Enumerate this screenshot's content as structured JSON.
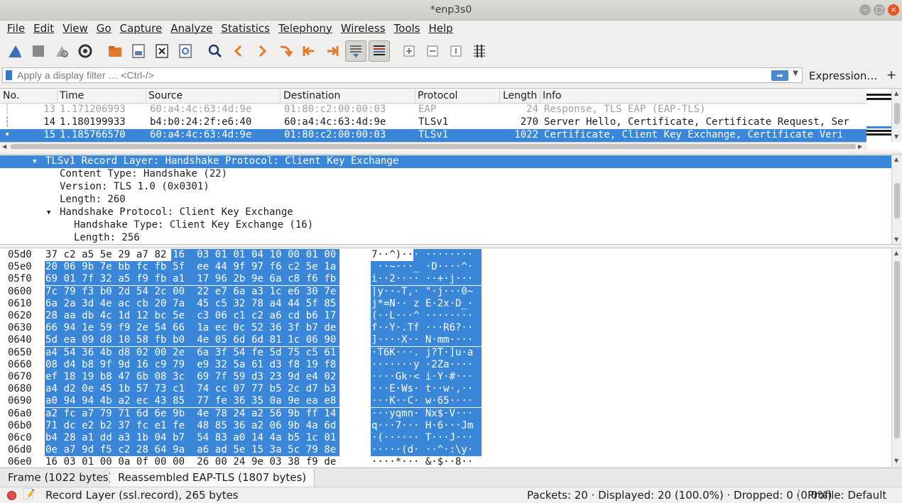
{
  "window": {
    "title": "*enp3s0"
  },
  "menu": [
    "File",
    "Edit",
    "View",
    "Go",
    "Capture",
    "Analyze",
    "Statistics",
    "Telephony",
    "Wireless",
    "Tools",
    "Help"
  ],
  "filter": {
    "placeholder": "Apply a display filter … <Ctrl-/>",
    "value": "",
    "expression_label": "Expression…",
    "add_label": "+"
  },
  "packet_list": {
    "columns": [
      "No.",
      "Time",
      "Source",
      "Destination",
      "Protocol",
      "Length",
      "Info"
    ],
    "rows": [
      {
        "no": "13",
        "time": "1.171206993",
        "source": "60:a4:4c:63:4d:9e",
        "destination": "01:80:c2:00:00:03",
        "protocol": "EAP",
        "length": "24",
        "info": "Response, TLS EAP (EAP-TLS)"
      },
      {
        "no": "14",
        "time": "1.180199933",
        "source": "b4:b0:24:2f:e6:40",
        "destination": "60:a4:4c:63:4d:9e",
        "protocol": "TLSv1",
        "length": "270",
        "info": "Server Hello, Certificate, Certificate Request, Ser"
      },
      {
        "no": "15",
        "time": "1.185766570",
        "source": "60:a4:4c:63:4d:9e",
        "destination": "01:80:c2:00:00:03",
        "protocol": "TLSv1",
        "length": "1022",
        "info": "Certificate, Client Key Exchange, Certificate Veri"
      }
    ]
  },
  "details": [
    "TLSv1 Record Layer: Handshake Protocol: Client Key Exchange",
    "Content Type: Handshake (22)",
    "Version: TLS 1.0 (0x0301)",
    "Length: 260",
    "Handshake Protocol: Client Key Exchange",
    "Handshake Type: Client Key Exchange (16)",
    "Length: 256"
  ],
  "bytes": [
    {
      "offset": "05d0",
      "hex": "37 c2 a5 5e 29 a7 82 16  03 01 01 04 10 00 01 00",
      "ascii": "7··^)··· ········"
    },
    {
      "offset": "05e0",
      "hex": "20 06 9b 7e bb fc fb 5f  ee 44 9f 97 f6 c2 5e 1a",
      "ascii": " ··~···_ ·D····^·"
    },
    {
      "offset": "05f0",
      "hex": "69 01 7f 32 a5 f9 fb a1  17 96 2b 9e 6a c8 f6 fb",
      "ascii": "i··2···· ··+·j···"
    },
    {
      "offset": "0600",
      "hex": "7c 79 f3 b0 2d 54 2c 00  22 e7 6a a3 1c e6 30 7e",
      "ascii": "|y··-T,· \"·j···0~"
    },
    {
      "offset": "0610",
      "hex": "6a 2a 3d 4e ac cb 20 7a  45 c5 32 78 a4 44 5f 85",
      "ascii": "j*=N·· z E·2x·D_·"
    },
    {
      "offset": "0620",
      "hex": "28 aa db 4c 1d 12 bc 5e  c3 06 c1 c2 a6 cd b6 17",
      "ascii": "(··L···^ ········"
    },
    {
      "offset": "0630",
      "hex": "66 94 1e 59 f9 2e 54 66  1a ec 0c 52 36 3f b7 de",
      "ascii": "f··Y·.Tf ···R6?··"
    },
    {
      "offset": "0640",
      "hex": "5d ea 09 d8 10 58 fb b0  4e 05 6d 6d 81 1c 06 90",
      "ascii": "]····X·· N·mm····"
    },
    {
      "offset": "0650",
      "hex": "a4 54 36 4b d8 02 00 2e  6a 3f 54 fe 5d 75 c5 61",
      "ascii": "·T6K···. j?T·]u·a"
    },
    {
      "offset": "0660",
      "hex": "08 d4 b8 9f 9d 16 c9 79  e9 32 5a 61 d3 f8 19 f8",
      "ascii": "·······y ·2Za····"
    },
    {
      "offset": "0670",
      "hex": "ef 18 19 b8 47 6b 08 3c  69 7f 59 d3 23 9d e4 02",
      "ascii": "····Gk·< i·Y·#···"
    },
    {
      "offset": "0680",
      "hex": "a4 d2 0e 45 1b 57 73 c1  74 cc 07 77 b5 2c d7 b3",
      "ascii": "···E·Ws· t··w·,··"
    },
    {
      "offset": "0690",
      "hex": "a0 94 94 4b a2 ec 43 85  77 fe 36 35 0a 9e ea e8",
      "ascii": "···K··C· w·65····"
    },
    {
      "offset": "06a0",
      "hex": "a2 fc a7 79 71 6d 6e 9b  4e 78 24 a2 56 9b ff 14",
      "ascii": "···yqmn· Nx$·V···"
    },
    {
      "offset": "06b0",
      "hex": "71 dc e2 b2 37 fc e1 fe  48 85 36 a2 06 9b 4a 6d",
      "ascii": "q···7··· H·6···Jm"
    },
    {
      "offset": "06c0",
      "hex": "b4 28 a1 dd a3 1b 04 b7  54 83 a0 14 4a b5 1c 01",
      "ascii": "·(······ T···J···"
    },
    {
      "offset": "06d0",
      "hex": "0e a7 9d f5 c2 28 64 9a  a6 ad 5e 15 3a 5c 79 8e",
      "ascii": "·····(d· ··^·:\\y·"
    },
    {
      "offset": "06e0",
      "hex": "16 03 01 00 0a 0f 00 00  26 00 24 9e 03 38 f9 de",
      "ascii": "····*··· &·$··8··"
    }
  ],
  "byte_tabs": [
    "Frame (1022 bytes)",
    "Reassembled EAP-TLS (1807 bytes)"
  ],
  "status": {
    "text": "Record Layer (ssl.record), 265 bytes",
    "packets": "Packets: 20 · Displayed: 20 (100.0%) · Dropped: 0 (0.0%)",
    "profile": "Profile: Default"
  },
  "colors": {
    "selection": "#3a86d8",
    "accent": "#e95420"
  }
}
